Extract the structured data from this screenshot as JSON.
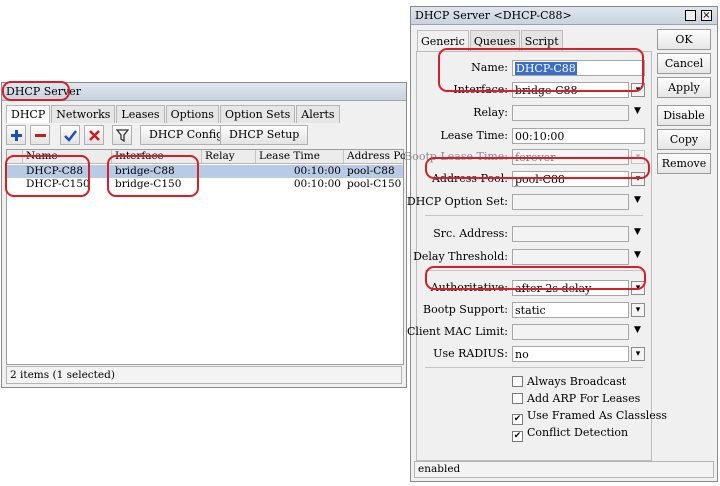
{
  "left_window": {
    "title": "DHCP Server",
    "tabs": [
      "DHCP",
      "Networks",
      "Leases",
      "Options",
      "Option Sets",
      "Alerts"
    ],
    "toolbar": {
      "add_icon": "plus-icon",
      "remove_icon": "minus-icon",
      "enable_icon": "check-icon",
      "disable_icon": "x-icon",
      "filter_icon": "filter-icon",
      "dhcp_config_label": "DHCP Config",
      "dhcp_setup_label": "DHCP Setup"
    },
    "table": {
      "columns": [
        "Name",
        "Interface",
        "Relay",
        "Lease Time",
        "Address Pool"
      ],
      "rows": [
        {
          "name": "DHCP-C88",
          "interface": "bridge-C88",
          "relay": "",
          "lease_time": "00:10:00",
          "address_pool": "pool-C88",
          "selected": true
        },
        {
          "name": "DHCP-C150",
          "interface": "bridge-C150",
          "relay": "",
          "lease_time": "00:10:00",
          "address_pool": "pool-C150",
          "selected": false
        }
      ]
    },
    "status": "2 items (1 selected)"
  },
  "right_window": {
    "title": "DHCP Server <DHCP-C88>",
    "tabs": [
      "Generic",
      "Queues",
      "Script"
    ],
    "fields": {
      "name": {
        "label": "Name:",
        "value": "DHCP-C88"
      },
      "interface": {
        "label": "Interface:",
        "value": "bridge-C88"
      },
      "relay": {
        "label": "Relay:",
        "value": ""
      },
      "lease_time": {
        "label": "Lease Time:",
        "value": "00:10:00"
      },
      "bootp_lease_time": {
        "label": "Bootp Lease Time:",
        "value": "forever"
      },
      "address_pool": {
        "label": "Address Pool:",
        "value": "pool-C88"
      },
      "dhcp_option_set": {
        "label": "DHCP Option Set:",
        "value": ""
      },
      "src_address": {
        "label": "Src. Address:",
        "value": ""
      },
      "delay_threshold": {
        "label": "Delay Threshold:",
        "value": ""
      },
      "authoritative": {
        "label": "Authoritative:",
        "value": "after 2s delay"
      },
      "bootp_support": {
        "label": "Bootp Support:",
        "value": "static"
      },
      "client_mac_limit": {
        "label": "Client MAC Limit:",
        "value": ""
      },
      "use_radius": {
        "label": "Use RADIUS:",
        "value": "no"
      }
    },
    "checkboxes": [
      {
        "label": "Always Broadcast",
        "checked": false
      },
      {
        "label": "Add ARP For Leases",
        "checked": false
      },
      {
        "label": "Use Framed As Classless",
        "checked": true
      },
      {
        "label": "Conflict Detection",
        "checked": true
      }
    ],
    "buttons": [
      "OK",
      "Cancel",
      "Apply",
      "Disable",
      "Copy",
      "Remove"
    ],
    "status": "enabled"
  },
  "colors": {
    "highlight": "#d4202a",
    "selected_row": "#b7cbe6",
    "text_selection": "#3a6ec9"
  }
}
